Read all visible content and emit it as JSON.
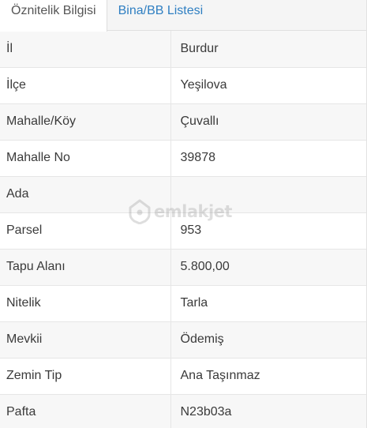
{
  "tabs": [
    {
      "label": "Öznitelik Bilgisi",
      "active": true
    },
    {
      "label": "Bina/BB Listesi",
      "active": false
    }
  ],
  "attributes": [
    {
      "key": "İl",
      "value": "Burdur"
    },
    {
      "key": "İlçe",
      "value": "Yeşilova"
    },
    {
      "key": "Mahalle/Köy",
      "value": "Çuvallı"
    },
    {
      "key": "Mahalle No",
      "value": "39878"
    },
    {
      "key": "Ada",
      "value": ""
    },
    {
      "key": "Parsel",
      "value": "953"
    },
    {
      "key": "Tapu Alanı",
      "value": "5.800,00"
    },
    {
      "key": "Nitelik",
      "value": "Tarla"
    },
    {
      "key": "Mevkii",
      "value": "Ödemiş"
    },
    {
      "key": "Zemin Tip",
      "value": "Ana Taşınmaz"
    },
    {
      "key": "Pafta",
      "value": "N23b03a"
    }
  ],
  "watermark": {
    "text": "emlakjet",
    "icon": "house-location-pin-icon"
  },
  "colors": {
    "tab_inactive_text": "#2f7fc2",
    "row_odd": "#f7f7f7",
    "row_even": "#ffffff"
  }
}
